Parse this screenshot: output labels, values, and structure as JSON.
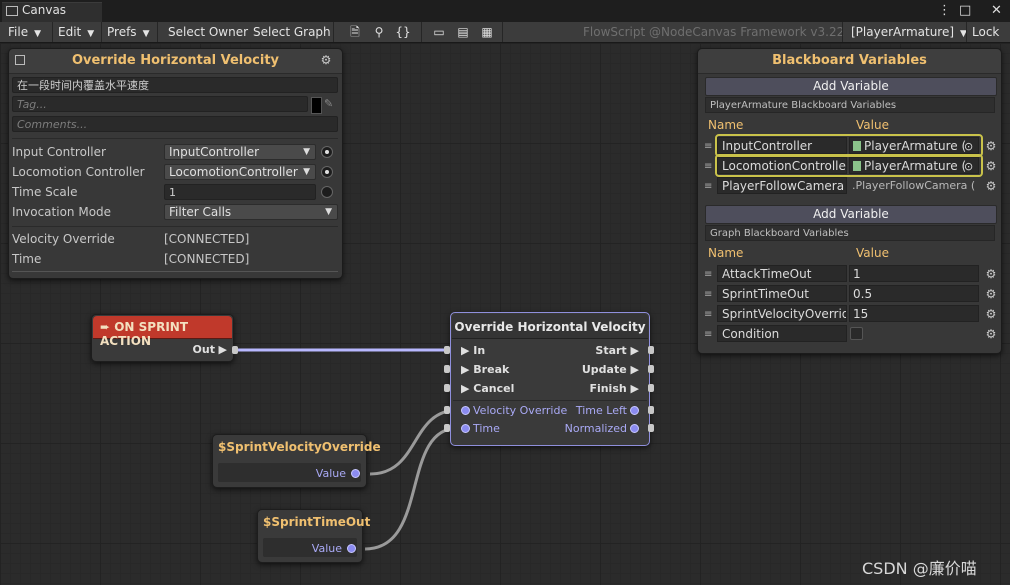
{
  "window": {
    "tab_title": "Canvas",
    "controls": [
      "⋮",
      "□",
      "✕"
    ]
  },
  "toolbar": {
    "file": "File",
    "edit": "Edit",
    "prefs": "Prefs",
    "select_owner": "Select Owner",
    "select_graph": "Select Graph",
    "watermark": "FlowScript @NodeCanvas Framework v3.22",
    "owner_selector": "[PlayerArmature]",
    "lock": "Lock",
    "icons": [
      "document-icon",
      "search-icon",
      "braces-icon",
      "layout-icon-1",
      "layout-icon-2",
      "layout-icon-3"
    ]
  },
  "inspector": {
    "title": "Override Horizontal Velocity",
    "name_value": "在一段时间内覆盖水平速度",
    "tag_placeholder": "Tag...",
    "comments_placeholder": "Comments...",
    "fields": [
      {
        "label": "Input Controller",
        "value": "InputController",
        "type": "dropdown",
        "radio": "on"
      },
      {
        "label": "Locomotion Controller",
        "value": "LocomotionController",
        "type": "dropdown",
        "radio": "on"
      },
      {
        "label": "Time Scale",
        "value": "1",
        "type": "text",
        "radio": "off"
      },
      {
        "label": "Invocation Mode",
        "value": "Filter Calls",
        "type": "dropdown",
        "radio": "none"
      }
    ],
    "connected": [
      {
        "label": "Velocity Override",
        "value": "[CONNECTED]"
      },
      {
        "label": "Time",
        "value": "[CONNECTED]"
      }
    ]
  },
  "blackboard": {
    "title": "Blackboard Variables",
    "add_variable": "Add Variable",
    "section1_title": "PlayerArmature Blackboard Variables",
    "section2_title": "Graph Blackboard Variables",
    "col_name": "Name",
    "col_value": "Value",
    "section1_vars": [
      {
        "name": "InputController",
        "value": "PlayerArmature (",
        "kind": "object",
        "highlight": true
      },
      {
        "name": "LocomotionController",
        "value": "PlayerArmature (",
        "kind": "object",
        "highlight": true
      },
      {
        "name": "PlayerFollowCamera",
        "value": ".PlayerFollowCamera (",
        "kind": "plain",
        "highlight": false
      }
    ],
    "section2_vars": [
      {
        "name": "AttackTimeOut",
        "value": "1"
      },
      {
        "name": "SprintTimeOut",
        "value": "0.5"
      },
      {
        "name": "SprintVelocityOverride",
        "value": "15"
      },
      {
        "name": "Condition",
        "value": ""
      }
    ]
  },
  "nodes": {
    "event": {
      "title": "➨ ON SPRINT ACTION",
      "out_label": "Out"
    },
    "action": {
      "title": "Override Horizontal Velocity",
      "flow_in": [
        "In",
        "Break",
        "Cancel"
      ],
      "flow_out": [
        "Start",
        "Update",
        "Finish"
      ],
      "value_in": [
        "Velocity Override",
        "Time"
      ],
      "value_out": [
        "Time Left",
        "Normalized"
      ]
    },
    "var1": {
      "title": "$SprintVelocityOverride",
      "port": "Value"
    },
    "var2": {
      "title": "$SprintTimeOut",
      "port": "Value"
    }
  },
  "colors": {
    "accent_title": "#f0c070",
    "event_header": "#c0392b",
    "value_port": "#8b8bf0",
    "highlight": "#c9c24a"
  },
  "watermark": "CSDN @廉价喵"
}
